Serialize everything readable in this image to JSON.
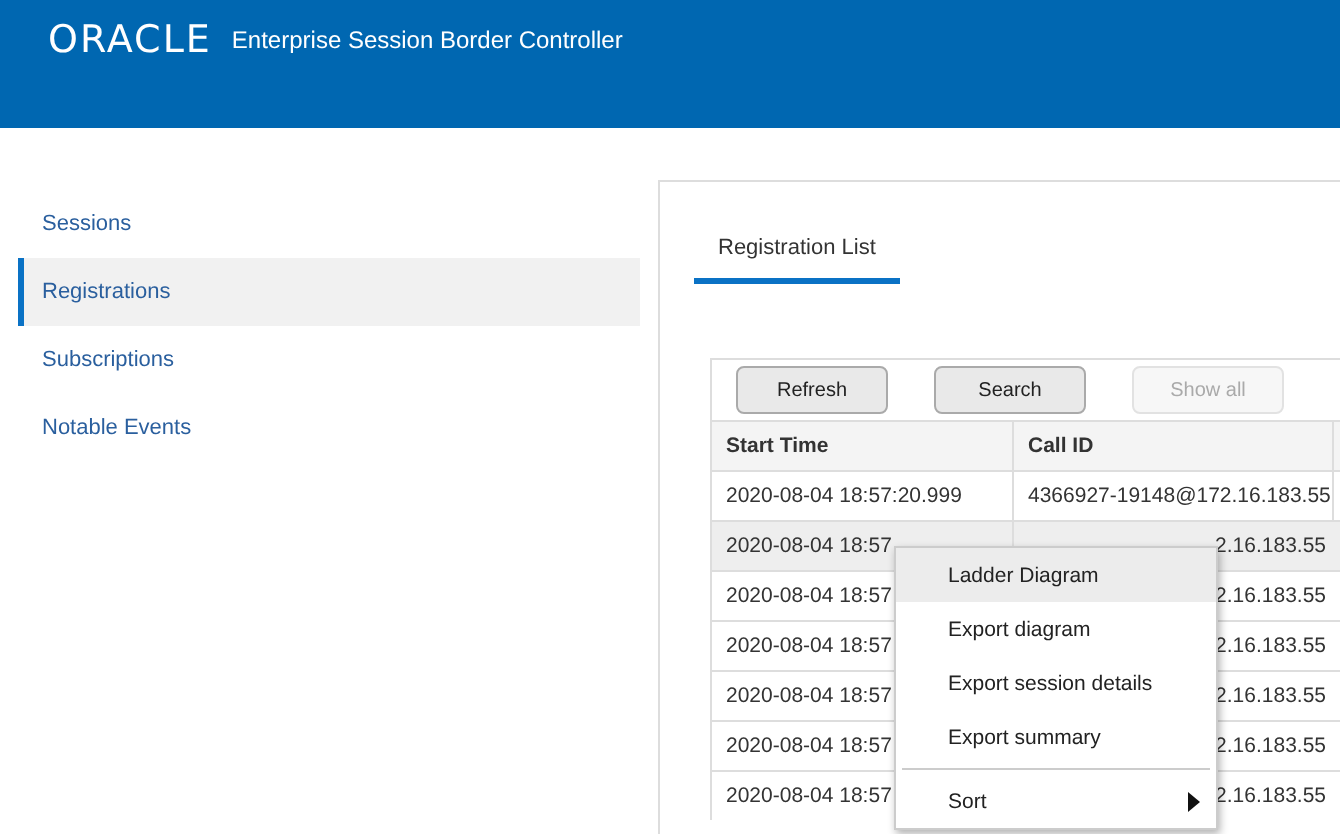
{
  "header": {
    "logo": "ORACLE",
    "title": "Enterprise Session Border Controller"
  },
  "sidebar": {
    "items": [
      {
        "label": "Sessions",
        "selected": false
      },
      {
        "label": "Registrations",
        "selected": true
      },
      {
        "label": "Subscriptions",
        "selected": false
      },
      {
        "label": "Notable Events",
        "selected": false
      }
    ]
  },
  "tabs": [
    {
      "label": "Registration List",
      "selected": true
    }
  ],
  "toolbar": [
    {
      "label": "Refresh",
      "disabled": false
    },
    {
      "label": "Search",
      "disabled": false
    },
    {
      "label": "Show all",
      "disabled": true
    }
  ],
  "table": {
    "columns": [
      "Start Time",
      "Call ID"
    ],
    "rows": [
      {
        "cells": [
          "2020-08-04 18:57:20.999",
          "4366927-19148@172.16.183.55"
        ],
        "selected": false
      },
      {
        "cells": [
          "2020-08-04 18:57",
          "2.16.183.55"
        ],
        "selected": true
      },
      {
        "cells": [
          "2020-08-04 18:57",
          "2.16.183.55"
        ],
        "selected": false
      },
      {
        "cells": [
          "2020-08-04 18:57",
          "2.16.183.55"
        ],
        "selected": false
      },
      {
        "cells": [
          "2020-08-04 18:57",
          "2.16.183.55"
        ],
        "selected": false
      },
      {
        "cells": [
          "2020-08-04 18:57",
          "2.16.183.55"
        ],
        "selected": false
      },
      {
        "cells": [
          "2020-08-04 18:57",
          "2.16.183.55"
        ],
        "selected": false
      }
    ]
  },
  "context_menu": {
    "items": [
      {
        "label": "Ladder Diagram",
        "kind": "item",
        "selected": true
      },
      {
        "label": "Export diagram",
        "kind": "item",
        "selected": false
      },
      {
        "label": "Export session details",
        "kind": "item",
        "selected": false
      },
      {
        "label": "Export summary",
        "kind": "item",
        "selected": false
      },
      {
        "label": "Sort",
        "kind": "submenu",
        "selected": false
      }
    ]
  }
}
